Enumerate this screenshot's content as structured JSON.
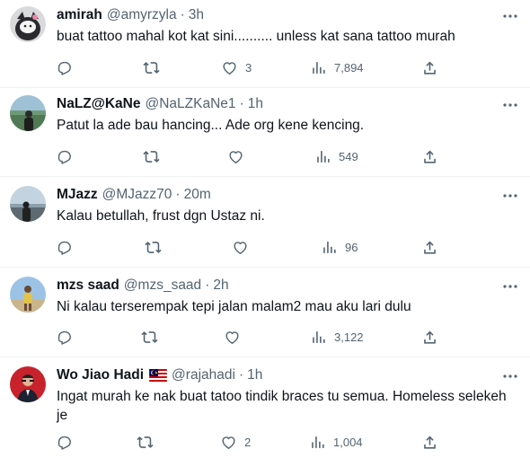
{
  "tweets": [
    {
      "display_name": "amirah",
      "handle": "@amyrzyla",
      "time": "3h",
      "text": "buat tattoo mahal kot kat sini.......... unless kat sana tattoo murah",
      "likes": "3",
      "views": "7,894"
    },
    {
      "display_name": "NaLZ@KaNe",
      "handle": "@NaLZKaNe1",
      "time": "1h",
      "text": "Patut la ade bau hancing... Ade org kene kencing.",
      "likes": "",
      "views": "549"
    },
    {
      "display_name": "MJazz",
      "handle": "@MJazz70",
      "time": "20m",
      "text": "Kalau betullah, frust dgn Ustaz ni.",
      "likes": "",
      "views": "96"
    },
    {
      "display_name": "mzs saad",
      "handle": "@mzs_saad",
      "time": "2h",
      "text": "Ni kalau terserempak tepi jalan malam2 mau aku lari dulu",
      "likes": "",
      "views": "3,122"
    },
    {
      "display_name": "Wo Jiao Hadi",
      "handle": "@rajahadi",
      "time": "1h",
      "text": "Ingat murah ke nak buat tatoo tindik braces tu semua. Homeless selekeh je",
      "likes": "2",
      "views": "1,004"
    }
  ],
  "separator": "·",
  "icons": {
    "reply": "reply-icon",
    "retweet": "retweet-icon",
    "like": "like-icon",
    "views": "views-icon",
    "share": "share-icon",
    "more": "more-icon",
    "flag": "malaysia-flag-icon"
  },
  "colors": {
    "text": "#0f1419",
    "muted": "#536471",
    "icon": "#536471",
    "divider": "#eff3f4"
  }
}
